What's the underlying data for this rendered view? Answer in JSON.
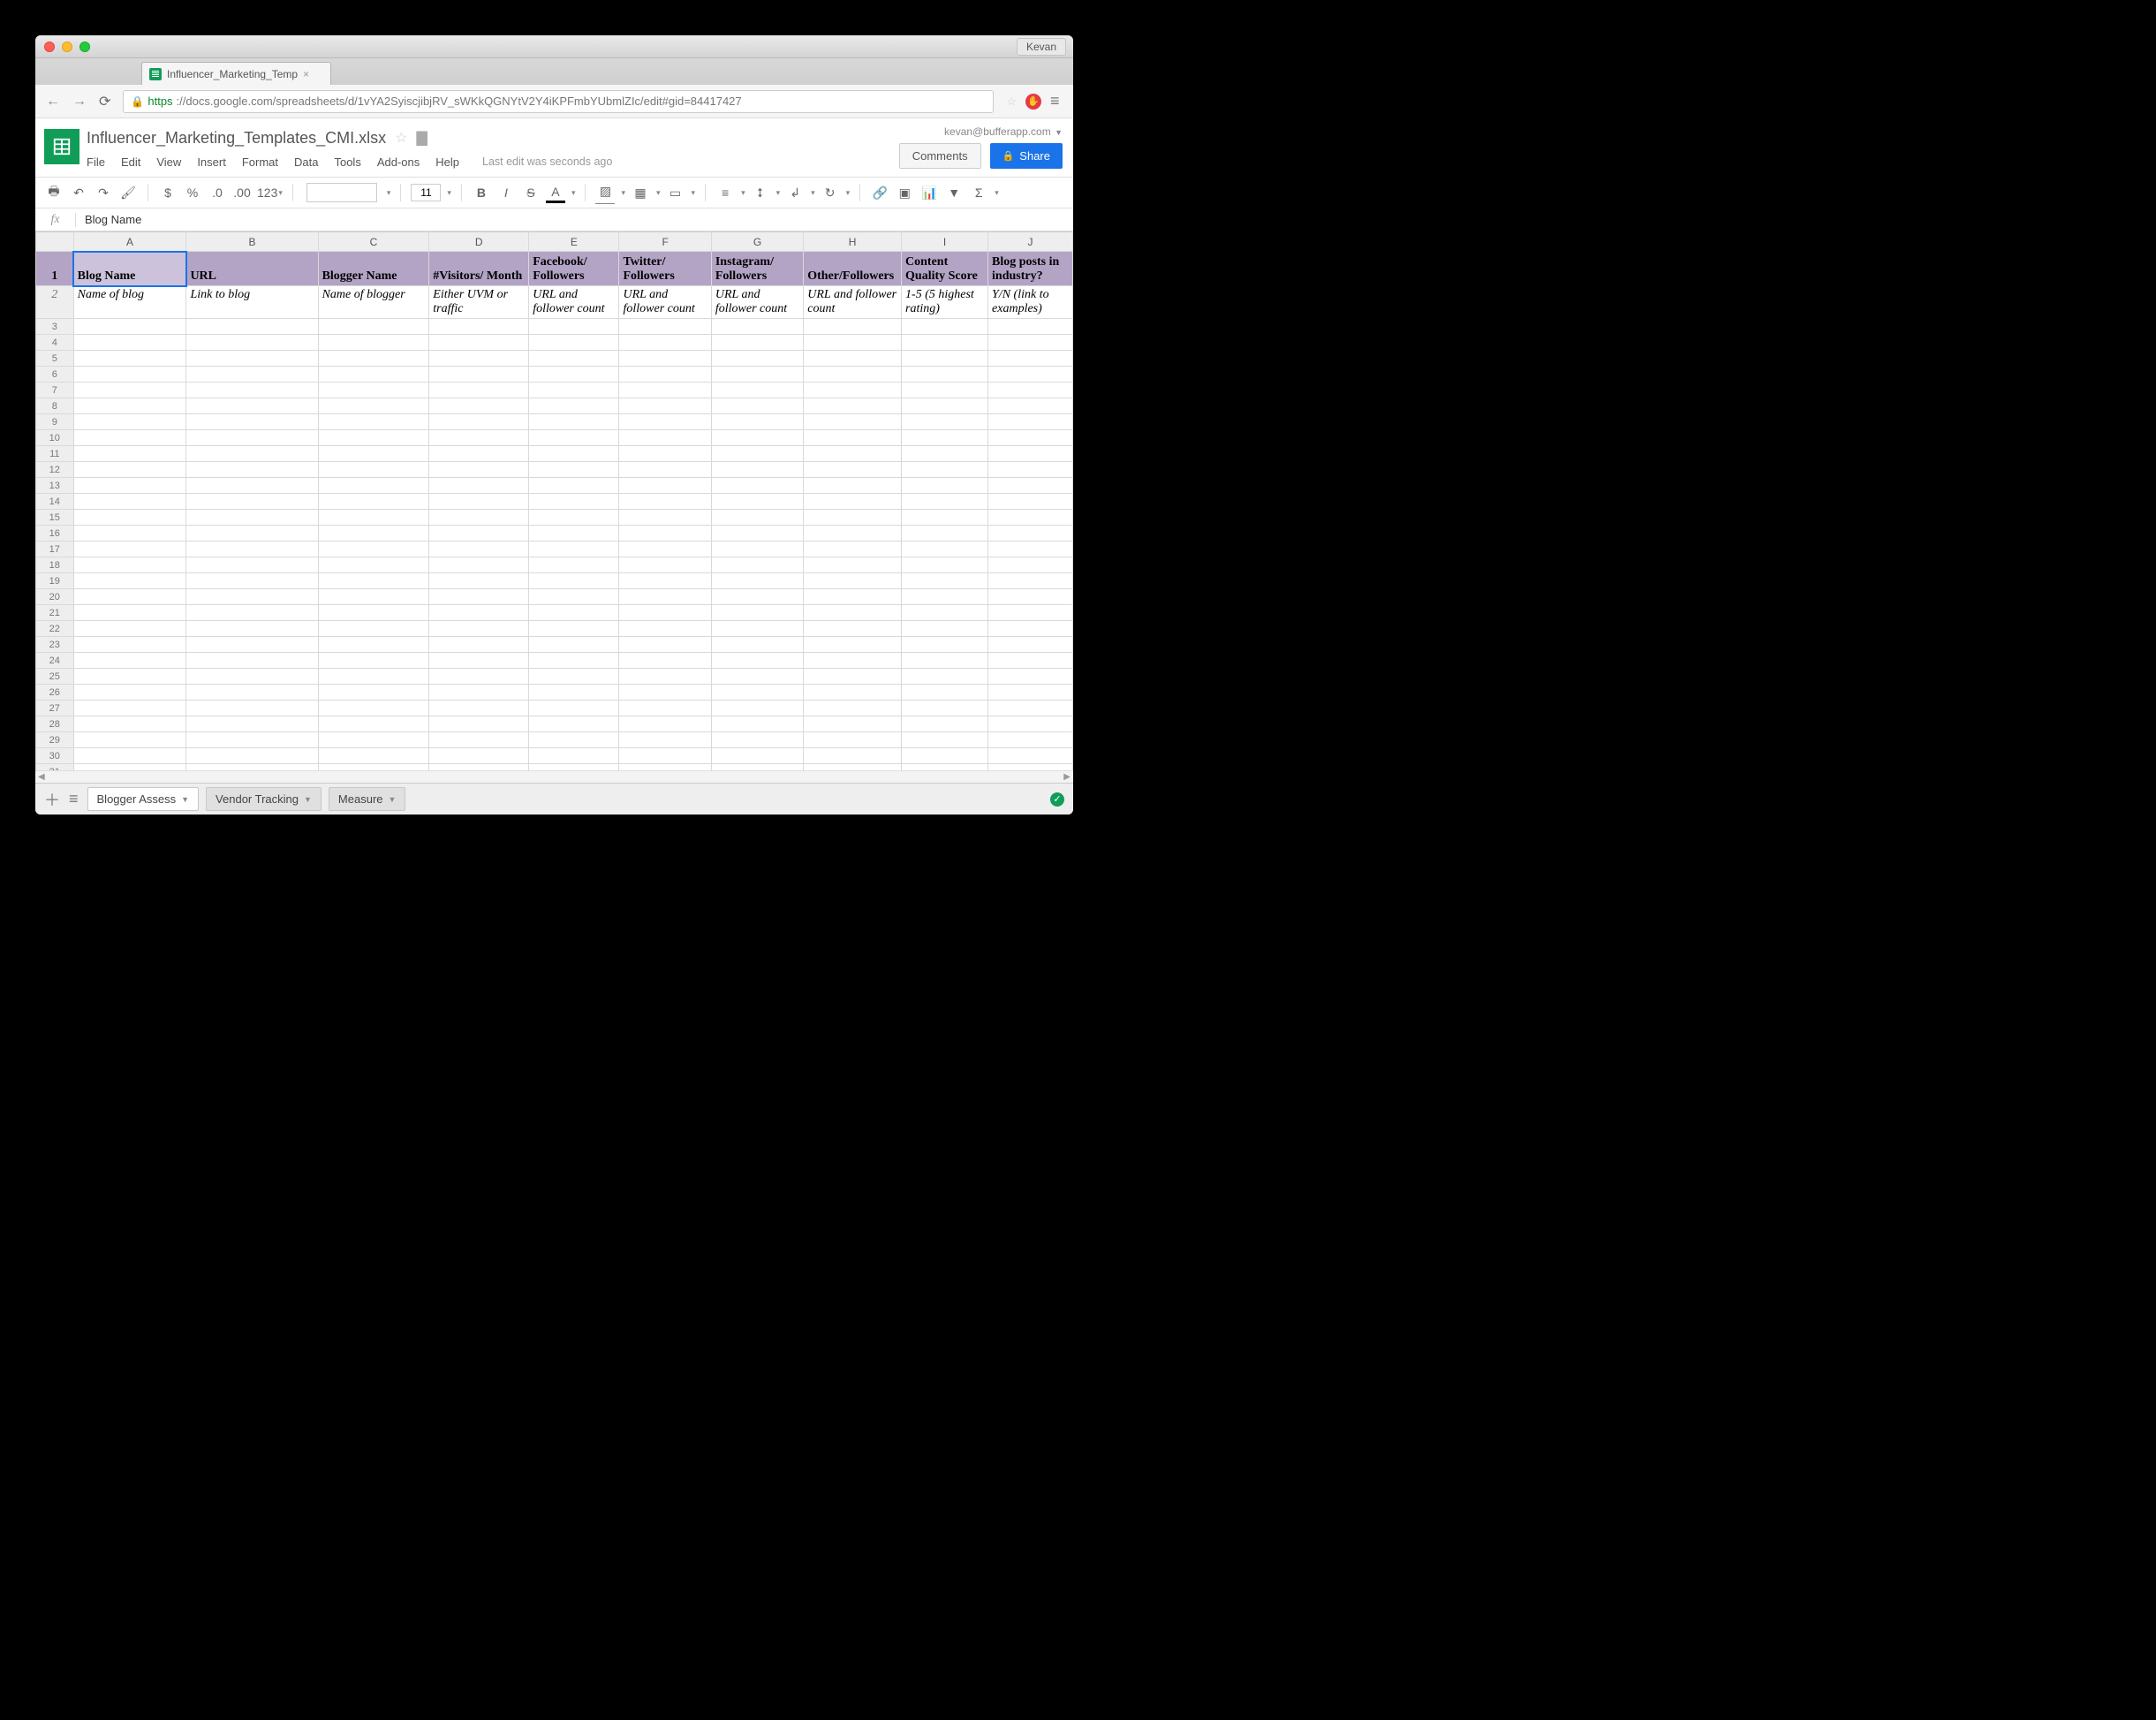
{
  "chrome": {
    "user_button": "Kevan",
    "tab_title": "Influencer_Marketing_Temp",
    "url_https": "https",
    "url_rest": "://docs.google.com/spreadsheets/d/1vYA2SyiscjibjRV_sWKkQGNYtV2Y4iKPFmbYUbmlZIc/edit#gid=84417427"
  },
  "doc": {
    "title": "Influencer_Marketing_Templates_CMI.xlsx",
    "user_email": "kevan@bufferapp.com",
    "comments_btn": "Comments",
    "share_btn": "Share",
    "last_edit": "Last edit was seconds ago",
    "menus": [
      "File",
      "Edit",
      "View",
      "Insert",
      "Format",
      "Data",
      "Tools",
      "Add-ons",
      "Help"
    ]
  },
  "toolbar": {
    "font_size": "11",
    "number_fmt": "123"
  },
  "formula_bar": {
    "fx": "fx",
    "value": "Blog Name"
  },
  "columns": [
    "A",
    "B",
    "C",
    "D",
    "E",
    "F",
    "G",
    "H",
    "I",
    "J"
  ],
  "headers": [
    "Blog Name",
    "URL",
    "Blogger Name",
    "#Visitors/ Month",
    "Facebook/ Followers",
    "Twitter/ Followers",
    "Instagram/ Followers",
    "Other/Followers",
    "Content Quality Score",
    "Blog posts in industry?"
  ],
  "row2": [
    "Name of blog",
    "Link to blog",
    "Name of blogger",
    "Either UVM or traffic",
    "URL and follower count",
    "URL and follower count",
    "URL and follower count",
    "URL and follower count",
    "1-5 (5 highest rating)",
    "Y/N (link to examples)"
  ],
  "row_count": 31,
  "sheets": {
    "tabs": [
      "Blogger Assess",
      "Vendor Tracking",
      "Measure"
    ],
    "active": 0
  }
}
